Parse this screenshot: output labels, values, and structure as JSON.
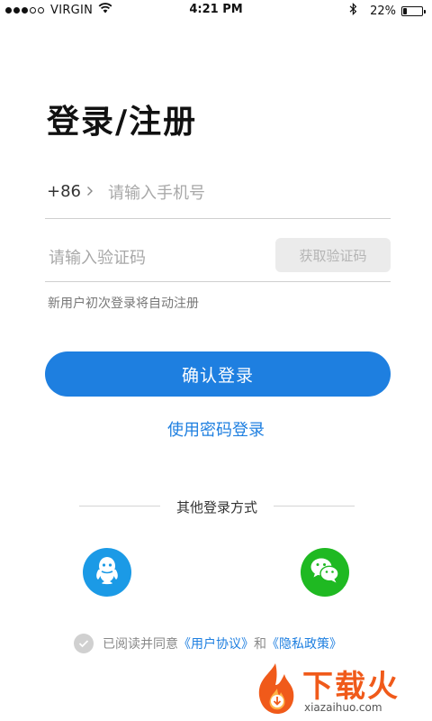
{
  "status_bar": {
    "carrier": "VIRGIN",
    "time": "4:21 PM",
    "battery_percent": "22%",
    "battery_level": 0.22,
    "signal_bars_filled": 3,
    "signal_bars_total": 5
  },
  "title": "登录/注册",
  "phone": {
    "country_code": "+86",
    "placeholder": "请输入手机号"
  },
  "code": {
    "placeholder": "请输入验证码",
    "get_code_label": "获取验证码"
  },
  "hint": "新用户初次登录将自动注册",
  "confirm_label": "确认登录",
  "password_login_label": "使用密码登录",
  "other_methods_label": "其他登录方式",
  "social": [
    {
      "name": "qq-icon",
      "color": "#1b9ae6"
    },
    {
      "name": "wechat-icon",
      "color": "#1fb922"
    }
  ],
  "agreement": {
    "prefix": "已阅读并同意",
    "user_agreement": "《用户协议》",
    "and": "和",
    "privacy_policy": "《隐私政策》"
  },
  "watermark": {
    "brand": "下载火",
    "domain": "xiazaihuo.com"
  },
  "colors": {
    "accent": "#1e7fe0",
    "button_disabled_bg": "#ebebeb",
    "qq": "#1b9ae6",
    "wechat": "#1fb922",
    "watermark": "#f05a1a"
  }
}
